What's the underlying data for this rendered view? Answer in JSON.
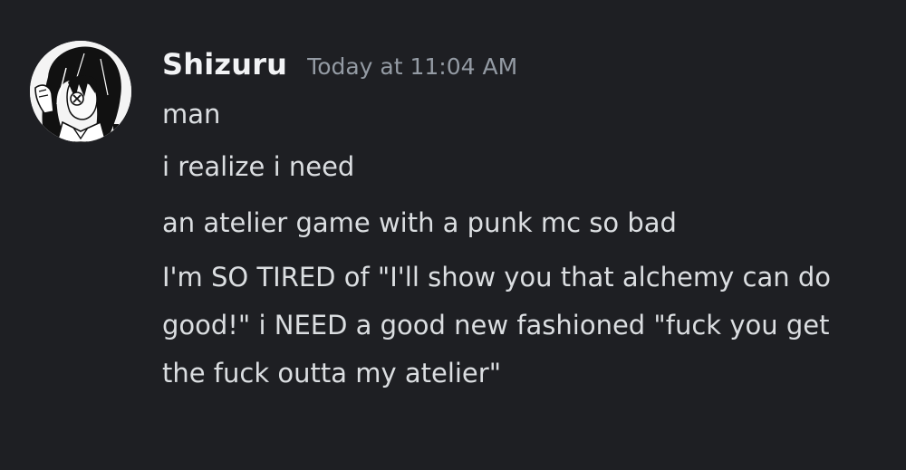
{
  "message": {
    "username": "Shizuru",
    "timestamp": "Today at 11:04 AM",
    "avatar_icon": "anime-girl-avatar-icon",
    "lines": [
      "man",
      "i realize i need",
      "an atelier game with a punk mc so bad",
      "I'm SO TIRED of \"I'll show you that alchemy can do good!\" i NEED a good new fashioned \"fuck you get the fuck outta my atelier\""
    ]
  },
  "colors": {
    "background": "#1e1f23",
    "username": "#f2f3f5",
    "timestamp": "#949ba4",
    "text": "#dbdee1"
  }
}
